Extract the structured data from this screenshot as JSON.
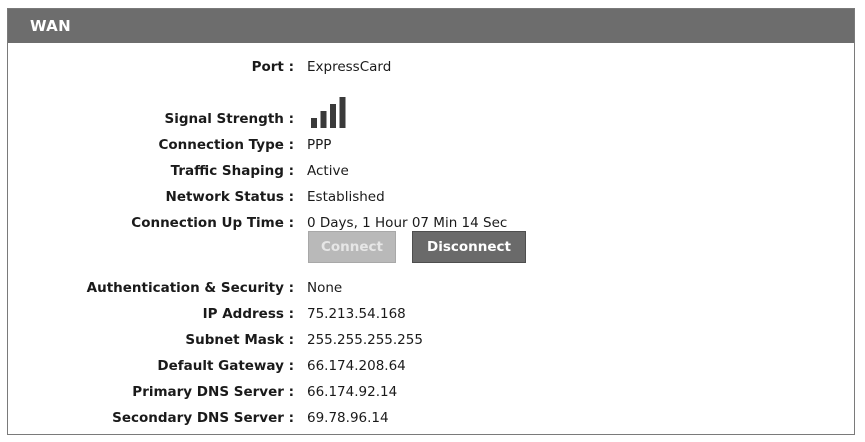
{
  "panel": {
    "title": "WAN"
  },
  "fields": {
    "port": {
      "label": "Port :",
      "value": "ExpressCard"
    },
    "signal_strength": {
      "label": "Signal Strength :",
      "bars": 4,
      "max_bars": 4
    },
    "connection_type": {
      "label": "Connection Type :",
      "value": "PPP"
    },
    "traffic_shaping": {
      "label": "Traffic Shaping :",
      "value": "Active"
    },
    "network_status": {
      "label": "Network Status :",
      "value": "Established"
    },
    "connection_up_time": {
      "label": "Connection Up Time :",
      "value": "0 Days, 1 Hour 07 Min 14 Sec"
    },
    "auth_security": {
      "label": "Authentication & Security :",
      "value": "None"
    },
    "ip_address": {
      "label": "IP Address :",
      "value": "75.213.54.168"
    },
    "subnet_mask": {
      "label": "Subnet Mask :",
      "value": "255.255.255.255"
    },
    "default_gateway": {
      "label": "Default Gateway :",
      "value": "66.174.208.64"
    },
    "primary_dns": {
      "label": "Primary DNS Server :",
      "value": "66.174.92.14"
    },
    "secondary_dns": {
      "label": "Secondary DNS Server :",
      "value": "69.78.96.14"
    }
  },
  "buttons": {
    "connect": {
      "label": "Connect",
      "enabled": false
    },
    "disconnect": {
      "label": "Disconnect",
      "enabled": true
    }
  },
  "colors": {
    "header_bg": "#6d6d6d",
    "button_disabled_bg": "#b9b9b9",
    "button_active_bg": "#6a6a6a"
  }
}
